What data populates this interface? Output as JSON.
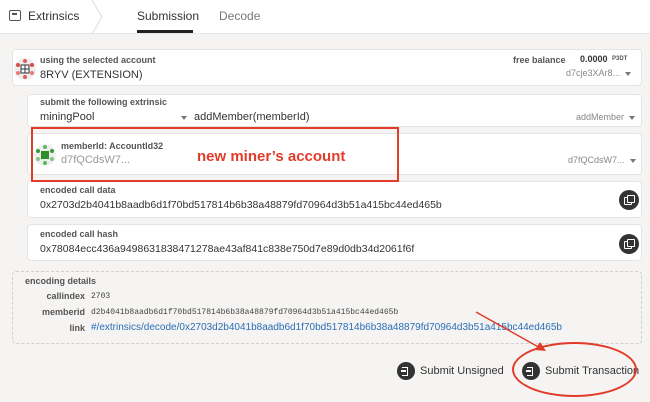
{
  "header": {
    "section_title": "Extrinsics",
    "tabs": [
      {
        "label": "Submission",
        "active": true
      },
      {
        "label": "Decode",
        "active": false
      }
    ]
  },
  "account": {
    "label": "using the selected account",
    "name": "8RYV (EXTENSION)",
    "balance_label": "free balance",
    "balance_value": "0.0000",
    "balance_unit": "P3DT",
    "address_short": "d7cje3XAr8..."
  },
  "extrinsic": {
    "label": "submit the following extrinsic",
    "pallet": "miningPool",
    "call": "addMember(memberId)",
    "call_short": "addMember"
  },
  "member": {
    "label": "memberId: AccountId32",
    "value": "d7fQCdsW7...",
    "value_right": "d7fQCdsW7..."
  },
  "encoded_call_data": {
    "label": "encoded call data",
    "value": "0x2703d2b4041b8aadb6d1f70bd517814b6b38a48879fd70964d3b51a415bc44ed465b"
  },
  "encoded_call_hash": {
    "label": "encoded call hash",
    "value": "0x78084ecc436a9498631838471278ae43af841c838e750d7e89d0db34d2061f6f"
  },
  "encoding_details": {
    "label": "encoding details",
    "rows": [
      {
        "key": "callindex",
        "value": "2703"
      },
      {
        "key": "memberid",
        "value": "d2b4041b8aadb6d1f70bd517814b6b38a48879fd70964d3b51a415bc44ed465b"
      },
      {
        "key": "link",
        "value": "#/extrinsics/decode/0x2703d2b4041b8aadb6d1f70bd517814b6b38a48879fd70964d3b51a415bc44ed465b"
      }
    ]
  },
  "actions": {
    "submit_unsigned": "Submit Unsigned",
    "submit_transaction": "Submit Transaction"
  },
  "annotation": {
    "text": "new miner’s account"
  },
  "colors": {
    "annotation_red": "#e23b2a",
    "link_blue": "#2a6fb5",
    "button_dark": "#333333"
  }
}
